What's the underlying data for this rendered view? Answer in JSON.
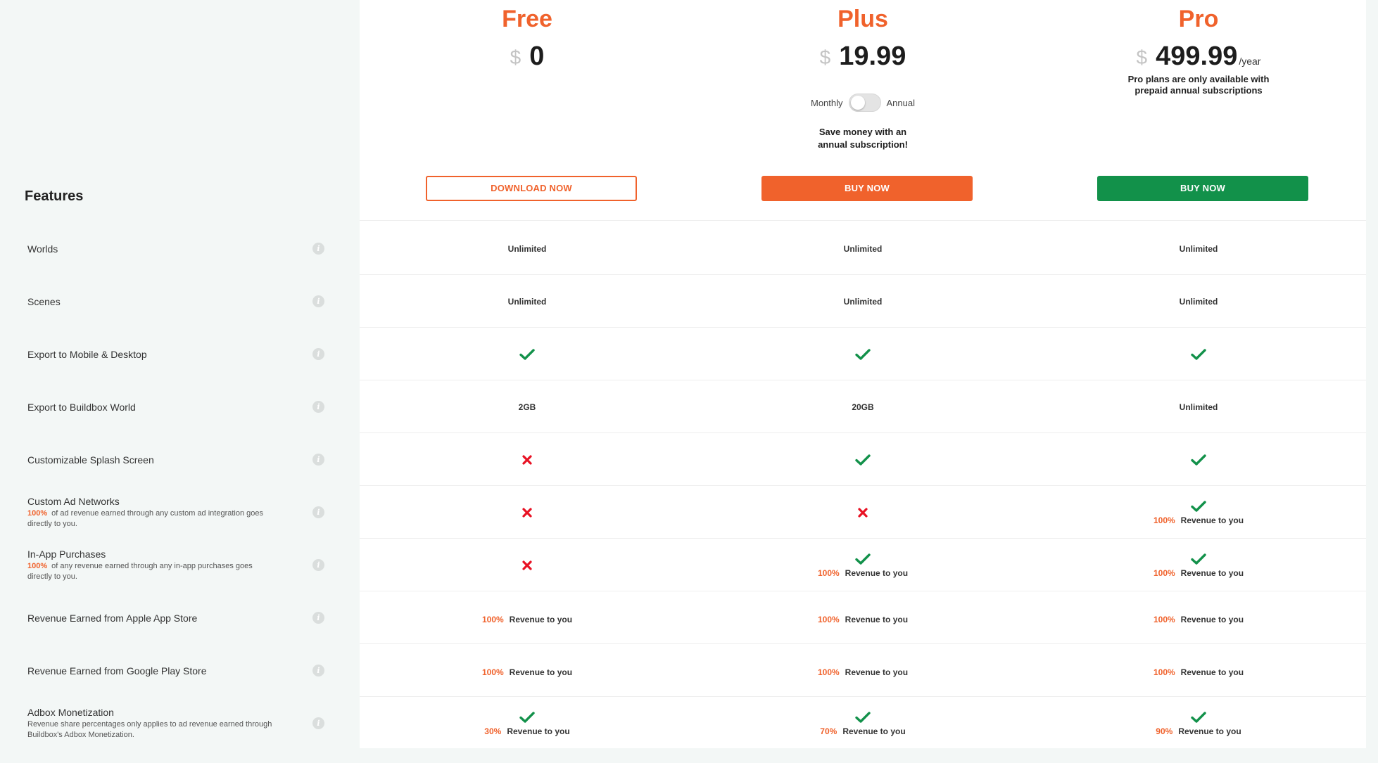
{
  "colors": {
    "accent_orange": "#f0622c",
    "buy_green": "#12914a",
    "check_green": "#12914a",
    "cross_red": "#e81123",
    "background": "#f3f7f6"
  },
  "plans": [
    {
      "name": "Free",
      "currency": "$",
      "price": "0",
      "per": "",
      "button": "DOWNLOAD NOW"
    },
    {
      "name": "Plus",
      "currency": "$",
      "price": "19.99",
      "per": "",
      "button": "BUY NOW",
      "toggle_left": "Monthly",
      "toggle_right": "Annual",
      "note_line1": "Save money with an",
      "note_line2": "annual subscription!"
    },
    {
      "name": "Pro",
      "currency": "$",
      "price": "499.99",
      "per": "/year",
      "button": "BUY NOW",
      "note_line1": "Pro plans are only available with",
      "note_line2": "prepaid annual subscriptions"
    }
  ],
  "features_title": "Features",
  "features": [
    {
      "name": "Worlds",
      "desc_pct": "",
      "desc": "",
      "desc2": ""
    },
    {
      "name": "Scenes",
      "desc_pct": "",
      "desc": "",
      "desc2": ""
    },
    {
      "name": "Export to Mobile & Desktop",
      "desc_pct": "",
      "desc": "",
      "desc2": ""
    },
    {
      "name": "Export to Buildbox World",
      "desc_pct": "",
      "desc": "",
      "desc2": ""
    },
    {
      "name": "Customizable Splash Screen",
      "desc_pct": "",
      "desc": "",
      "desc2": ""
    },
    {
      "name": "Custom Ad Networks",
      "desc_pct": "100%",
      "desc": "of ad revenue earned through any custom ad integration goes",
      "desc2": "directly to you."
    },
    {
      "name": "In-App Purchases",
      "desc_pct": "100%",
      "desc": "of any revenue earned through any in-app purchases goes",
      "desc2": "directly to you."
    },
    {
      "name": "Revenue Earned from Apple App Store",
      "desc_pct": "",
      "desc": "",
      "desc2": ""
    },
    {
      "name": "Revenue Earned from Google Play Store",
      "desc_pct": "",
      "desc": "",
      "desc2": ""
    },
    {
      "name": "Adbox Monetization",
      "desc_pct": "",
      "desc": "Revenue share percentages only applies to ad revenue earned through",
      "desc2": "Buildbox's Adbox Monetization."
    }
  ],
  "revenue_label": "Revenue to you",
  "cells": [
    [
      {
        "text": "Unlimited"
      },
      {
        "text": "Unlimited"
      },
      {
        "text": "Unlimited"
      }
    ],
    [
      {
        "text": "Unlimited"
      },
      {
        "text": "Unlimited"
      },
      {
        "text": "Unlimited"
      }
    ],
    [
      {
        "icon": "check-icon"
      },
      {
        "icon": "check-icon"
      },
      {
        "icon": "check-icon"
      }
    ],
    [
      {
        "text": "2GB"
      },
      {
        "text": "20GB"
      },
      {
        "text": "Unlimited"
      }
    ],
    [
      {
        "icon": "cross-icon"
      },
      {
        "icon": "check-icon"
      },
      {
        "icon": "check-icon"
      }
    ],
    [
      {
        "icon": "cross-icon"
      },
      {
        "icon": "cross-icon"
      },
      {
        "icon": "check-icon",
        "pct": "100%"
      }
    ],
    [
      {
        "icon": "cross-icon"
      },
      {
        "icon": "check-icon",
        "pct": "100%"
      },
      {
        "icon": "check-icon",
        "pct": "100%"
      }
    ],
    [
      {
        "pct": "100%"
      },
      {
        "pct": "100%"
      },
      {
        "pct": "100%"
      }
    ],
    [
      {
        "pct": "100%"
      },
      {
        "pct": "100%"
      },
      {
        "pct": "100%"
      }
    ],
    [
      {
        "icon": "check-icon",
        "pct": "30%"
      },
      {
        "icon": "check-icon",
        "pct": "70%"
      },
      {
        "icon": "check-icon",
        "pct": "90%"
      }
    ]
  ]
}
